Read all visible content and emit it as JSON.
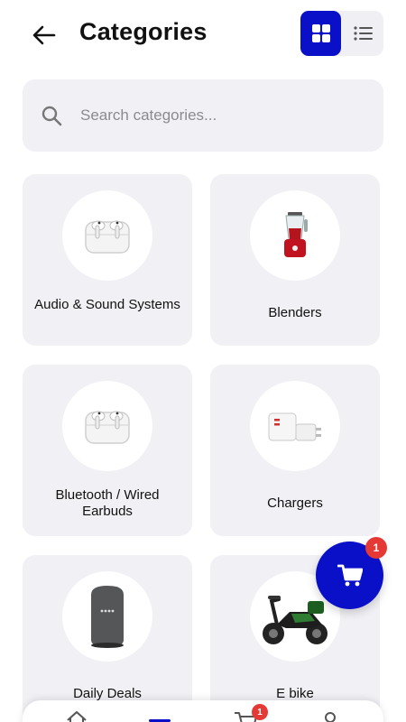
{
  "header": {
    "title": "Categories",
    "back_icon": "arrow-left-icon",
    "view_grid_icon": "grid-view-icon",
    "view_list_icon": "list-view-icon",
    "active_view": "grid"
  },
  "search": {
    "placeholder": "Search categories...",
    "value": "",
    "icon": "search-icon"
  },
  "categories": [
    {
      "label": "Audio & Sound Systems",
      "image": "earbuds-case-image"
    },
    {
      "label": "Blenders",
      "image": "blender-image"
    },
    {
      "label": "Bluetooth / Wired Earbuds",
      "image": "earbuds-case-image"
    },
    {
      "label": "Chargers",
      "image": "charger-image"
    },
    {
      "label": "Daily Deals",
      "image": "smart-speaker-image"
    },
    {
      "label": "E bike",
      "image": "e-bike-image"
    }
  ],
  "cart_fab": {
    "icon": "cart-icon",
    "badge": "1"
  },
  "bottom_nav": {
    "items": [
      "home-icon",
      "categories-icon",
      "cart-icon",
      "profile-icon"
    ],
    "active": "categories",
    "cart_badge": "1"
  },
  "colors": {
    "accent": "#0a10c8",
    "card_bg": "#f1f1f5",
    "badge": "#e53935"
  }
}
